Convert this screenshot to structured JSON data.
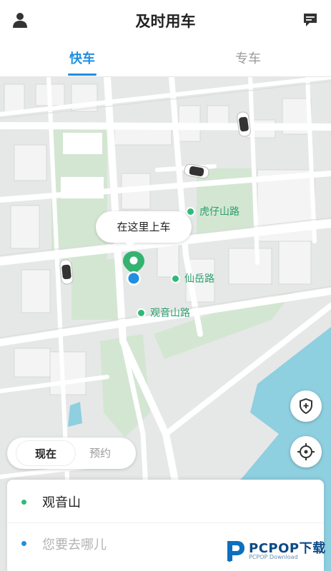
{
  "app": {
    "title": "及时用车"
  },
  "header": {
    "left_icon": "user-icon",
    "right_icon": "message-icon"
  },
  "tabs": [
    {
      "label": "快车",
      "active": true
    },
    {
      "label": "专车",
      "active": false
    }
  ],
  "map": {
    "pickup_callout": "在这里上车",
    "pois": [
      {
        "label": "虎仔山路"
      },
      {
        "label": "仙岳路"
      },
      {
        "label": "观音山路"
      }
    ],
    "colors": {
      "road": "#ffffff",
      "block": "#e4e6e5",
      "park": "#d3e6d2",
      "water": "#8ecfe0",
      "poi": "#2fba78",
      "pin": "#33b36f",
      "location": "#1f8fe0"
    }
  },
  "controls": {
    "shield_icon": "shield-plus-icon",
    "locate_icon": "crosshair-icon"
  },
  "time_toggle": {
    "now": "现在",
    "later": "预约"
  },
  "address": {
    "from": "观音山",
    "to_placeholder": "您要去哪儿"
  },
  "watermark": {
    "brand": "PCPOP下载",
    "sub": "PCPOP Download"
  }
}
